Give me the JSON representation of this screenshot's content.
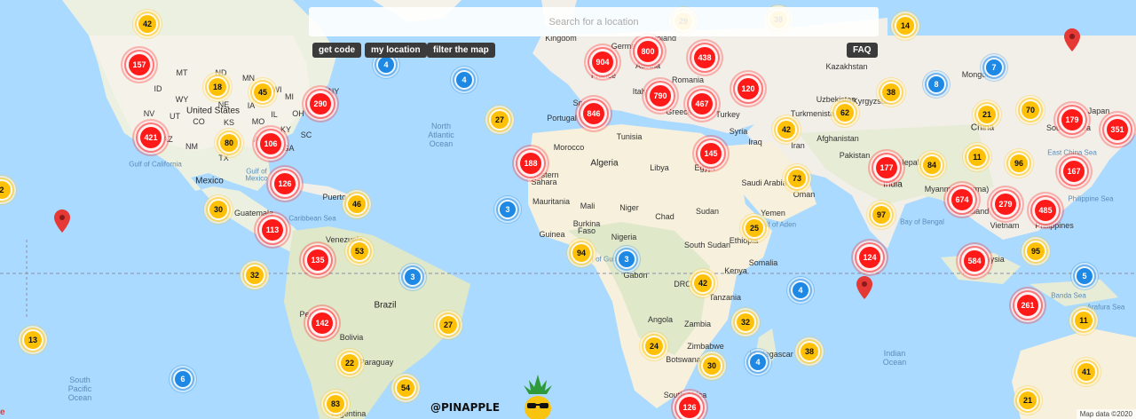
{
  "search": {
    "placeholder": "Search for a location"
  },
  "toolbar": {
    "get_code": "get code",
    "my_location": "my location",
    "filter": "filter the map",
    "faq": "FAQ"
  },
  "brand": {
    "handle": "@PINAPPLE"
  },
  "attribution": "Map data ©2020",
  "map_labels": {
    "north_atlantic_1": "North",
    "north_atlantic_2": "Atlantic",
    "north_atlantic_3": "Ocean",
    "south_pacific_1": "South",
    "south_pacific_2": "Pacific",
    "south_pacific_3": "Ocean",
    "indian_1": "Indian",
    "indian_2": "Ocean",
    "united_states": "United States",
    "mexico": "Mexico",
    "gulf_mexico_1": "Gulf of",
    "gulf_mexico_2": "Mexico",
    "caribbean": "Caribbean Sea",
    "venezuela": "Venezuela",
    "guatemala": "Guatemala",
    "puerto_rico": "Puerto Rico",
    "peru": "Peru",
    "brazil": "Brazil",
    "bolivia": "Bolivia",
    "paraguay": "Paraguay",
    "argentina": "Argentina",
    "portugal": "Portugal",
    "spain": "Spain",
    "france": "France",
    "germany": "German",
    "poland": "Poland",
    "austria": "Austria",
    "italy": "Italy",
    "greece": "Greece",
    "romania": "Romania",
    "turkey": "Turkey",
    "syria": "Syria",
    "iraq": "Iraq",
    "iran": "Iran",
    "kazakhstan": "Kazakhstan",
    "uzbekistan": "Uzbekistan",
    "turkmenistan": "Turkmenistan",
    "kyrgyzstan": "Kyrgyzstan",
    "afghanistan": "Afghanistan",
    "pakistan": "Pakistan",
    "nepal": "Nepal",
    "india": "India",
    "mongolia": "Mongolia",
    "china": "China",
    "south_korea": "South Korea",
    "japan": "Japan",
    "east_china_sea": "East China Sea",
    "myanmar": "Myanmar (Burma)",
    "thailand": "Thailand",
    "vietnam": "Vietnam",
    "philippines": "Philippines",
    "philippine_sea": "Philippine Sea",
    "malaysia": "Malaysia",
    "banda_sea": "Banda Sea",
    "arafura_sea": "Arafura Sea",
    "bay_of_bengal": "Bay of Bengal",
    "tunisia": "Tunisia",
    "morocco": "Morocco",
    "algeria": "Algeria",
    "libya": "Libya",
    "egypt": "Egypt",
    "western_sahara_1": "Western",
    "western_sahara_2": "Sahara",
    "mauritania": "Mauritania",
    "mali": "Mali",
    "niger": "Niger",
    "chad": "Chad",
    "sudan": "Sudan",
    "saudi_arabia": "Saudi Arabia",
    "oman": "Oman",
    "yemen": "Yemen",
    "gulf_aden": "Gulf of Aden",
    "guinea": "Guinea",
    "burkina_faso_1": "Burkina",
    "burkina_faso_2": "Faso",
    "nigeria": "Nigeria",
    "south_sudan": "South Sudan",
    "ethiopia": "Ethiopia",
    "somalia": "Somalia",
    "kenya": "Kenya",
    "gulf_guinea": "Gulf of Guinea",
    "gabon": "Gabon",
    "drc": "DRC",
    "tanzania": "Tanzania",
    "angola": "Angola",
    "zambia": "Zambia",
    "zimbabwe": "Zimbabwe",
    "madagascar": "Madagascar",
    "botswana": "Botswana",
    "south_africa": "South Africa",
    "mt": "MT",
    "nd": "ND",
    "mn": "MN",
    "id": "ID",
    "sd": "SD",
    "wy": "WY",
    "ne": "NE",
    "ia": "IA",
    "nv": "NV",
    "ut": "UT",
    "co": "CO",
    "ks": "KS",
    "mo": "MO",
    "ca": "CA",
    "az": "AZ",
    "nm": "NM",
    "ok": "OK",
    "tx": "TX",
    "ar": "AR",
    "wi": "WI",
    "mi": "MI",
    "il": "IL",
    "oh": "OH",
    "ky": "KY",
    "ga": "GA",
    "ny": "NY",
    "pa": "PA",
    "sc": "SC",
    "gulf_cal": "Gulf of California",
    "kingdom": "Kingdom"
  },
  "clusters": [
    {
      "v": "42",
      "c": "yellow"
    },
    {
      "v": "157",
      "c": "red"
    },
    {
      "v": "18",
      "c": "yellow"
    },
    {
      "v": "45",
      "c": "yellow"
    },
    {
      "v": "4",
      "c": "blue"
    },
    {
      "v": "4",
      "c": "blue"
    },
    {
      "v": "290",
      "c": "red"
    },
    {
      "v": "27",
      "c": "yellow"
    },
    {
      "v": "421",
      "c": "red"
    },
    {
      "v": "80",
      "c": "yellow"
    },
    {
      "v": "106",
      "c": "red"
    },
    {
      "v": "126",
      "c": "red"
    },
    {
      "v": "30",
      "c": "yellow"
    },
    {
      "v": "46",
      "c": "yellow"
    },
    {
      "v": "113",
      "c": "red"
    },
    {
      "v": "135",
      "c": "red"
    },
    {
      "v": "53",
      "c": "yellow"
    },
    {
      "v": "32",
      "c": "yellow"
    },
    {
      "v": "3",
      "c": "blue"
    },
    {
      "v": "3",
      "c": "blue"
    },
    {
      "v": "142",
      "c": "red"
    },
    {
      "v": "27",
      "c": "yellow"
    },
    {
      "v": "13",
      "c": "yellow"
    },
    {
      "v": "22",
      "c": "yellow"
    },
    {
      "v": "6",
      "c": "blue"
    },
    {
      "v": "54",
      "c": "yellow"
    },
    {
      "v": "83",
      "c": "yellow"
    },
    {
      "v": "904",
      "c": "red"
    },
    {
      "v": "800",
      "c": "red"
    },
    {
      "v": "438",
      "c": "red"
    },
    {
      "v": "846",
      "c": "red"
    },
    {
      "v": "790",
      "c": "red"
    },
    {
      "v": "467",
      "c": "red"
    },
    {
      "v": "120",
      "c": "red"
    },
    {
      "v": "188",
      "c": "red"
    },
    {
      "v": "145",
      "c": "red"
    },
    {
      "v": "14",
      "c": "yellow"
    },
    {
      "v": "38",
      "c": "yellow"
    },
    {
      "v": "62",
      "c": "yellow"
    },
    {
      "v": "42",
      "c": "yellow"
    },
    {
      "v": "73",
      "c": "yellow"
    },
    {
      "v": "25",
      "c": "yellow"
    },
    {
      "v": "94",
      "c": "yellow"
    },
    {
      "v": "3",
      "c": "blue"
    },
    {
      "v": "42",
      "c": "yellow"
    },
    {
      "v": "4",
      "c": "blue"
    },
    {
      "v": "32",
      "c": "yellow"
    },
    {
      "v": "24",
      "c": "yellow"
    },
    {
      "v": "30",
      "c": "yellow"
    },
    {
      "v": "4",
      "c": "blue"
    },
    {
      "v": "38",
      "c": "yellow"
    },
    {
      "v": "126",
      "c": "red"
    },
    {
      "v": "7",
      "c": "blue"
    },
    {
      "v": "8",
      "c": "blue"
    },
    {
      "v": "21",
      "c": "yellow"
    },
    {
      "v": "70",
      "c": "yellow"
    },
    {
      "v": "179",
      "c": "red"
    },
    {
      "v": "351",
      "c": "red"
    },
    {
      "v": "11",
      "c": "yellow"
    },
    {
      "v": "96",
      "c": "yellow"
    },
    {
      "v": "177",
      "c": "red"
    },
    {
      "v": "84",
      "c": "yellow"
    },
    {
      "v": "167",
      "c": "red"
    },
    {
      "v": "674",
      "c": "red"
    },
    {
      "v": "279",
      "c": "red"
    },
    {
      "v": "485",
      "c": "red"
    },
    {
      "v": "97",
      "c": "yellow"
    },
    {
      "v": "124",
      "c": "red"
    },
    {
      "v": "584",
      "c": "red"
    },
    {
      "v": "95",
      "c": "yellow"
    },
    {
      "v": "5",
      "c": "blue"
    },
    {
      "v": "261",
      "c": "red"
    },
    {
      "v": "11",
      "c": "yellow"
    },
    {
      "v": "41",
      "c": "yellow"
    },
    {
      "v": "21",
      "c": "yellow"
    },
    {
      "v": "2",
      "c": "yellow"
    },
    {
      "v": "29",
      "c": "yellow"
    },
    {
      "v": "39",
      "c": "yellow"
    }
  ],
  "colors": {
    "red": "#ff1a1a",
    "yellow": "#ffc107",
    "blue": "#1e88e5",
    "water": "#aadaff",
    "land": "#f2efe8"
  }
}
